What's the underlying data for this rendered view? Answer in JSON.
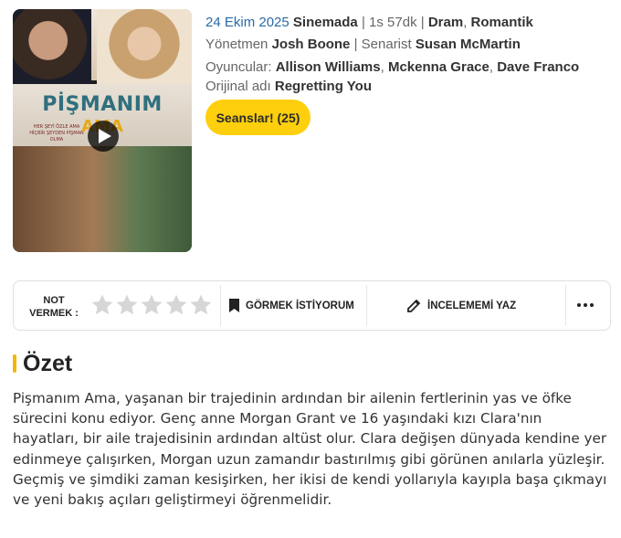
{
  "poster": {
    "title_line1": "PİŞMANIM",
    "title_line2": "AMA",
    "tagline": "HER ŞEYİ ÖZLE AMA HİÇBİR ŞEYDEN PİŞMAN OLMA",
    "play_icon": "play-icon"
  },
  "meta": {
    "release_date": "24 Ekim 2025",
    "release_status": "Sinemada",
    "duration": "1s 57dk",
    "genre1": "Dram",
    "genre2": "Romantik",
    "director_label": "Yönetmen",
    "director": "Josh Boone",
    "writer_label": "Senarist",
    "writer": "Susan McMartin",
    "cast_label": "Oyuncular:",
    "cast1": "Allison Williams",
    "cast2": "Mckenna Grace",
    "cast3": "Dave Franco",
    "original_label": "Orijinal adı",
    "original_title": "Regretting You",
    "sessions_button": "Seanslar! (25)"
  },
  "actions": {
    "rate_label_line1": "NOT",
    "rate_label_line2": "VERMEK :",
    "star_count": 5,
    "rating_value": 0,
    "watchlist_label": "GÖRMEK İSTİYORUM",
    "review_label": "İNCELEMEMİ YAZ",
    "more_icon": "more-icon"
  },
  "summary": {
    "heading": "Özet",
    "text": "Pişmanım Ama, yaşanan bir trajedinin ardından bir ailenin fertlerinin yas ve öfke sürecini konu ediyor. Genç anne Morgan Grant ve 16 yaşındaki kızı Clara'nın hayatları, bir aile trajedisinin ardından altüst olur. Clara değişen dünyada kendine yer edinmeye çalışırken, Morgan uzun zamandır bastırılmış gibi görünen anılarla yüzleşir. Geçmiş ve şimdiki zaman kesişirken, her ikisi de kendi yollarıyla kayıpla başa çıkmayı ve yeni bakış açıları geliştirmeyi öğrenmelidir."
  },
  "colors": {
    "accent_yellow": "#fecf0c",
    "date_blue": "#2a6aa6",
    "star_gray": "#d6d6d6"
  }
}
